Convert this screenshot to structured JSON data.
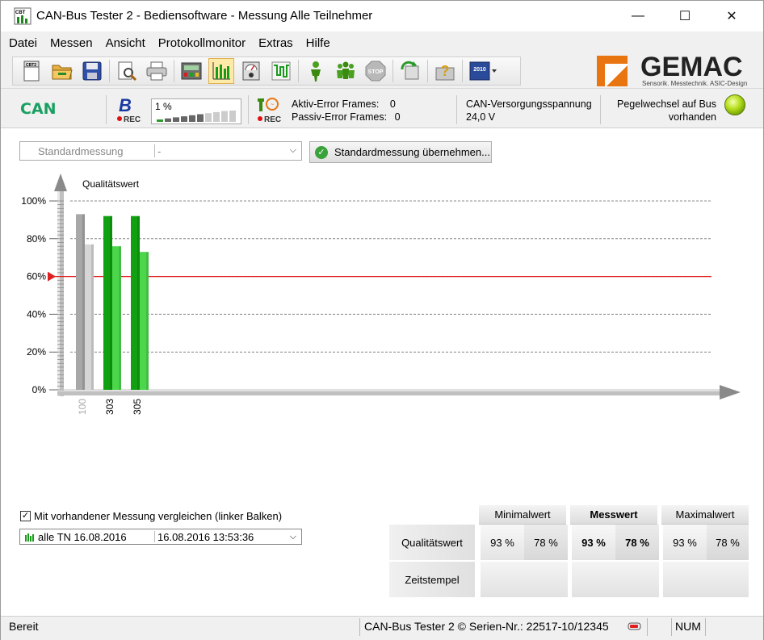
{
  "window": {
    "title": "CAN-Bus Tester 2 - Bediensoftware - Messung Alle Teilnehmer",
    "app_icon_text": "CBT",
    "controls": {
      "minimize": "—",
      "maximize": "☐",
      "close": "✕"
    }
  },
  "menu": [
    {
      "label": "Datei"
    },
    {
      "label": "Messen"
    },
    {
      "label": "Ansicht"
    },
    {
      "label": "Protokollmonitor"
    },
    {
      "label": "Extras"
    },
    {
      "label": "Hilfe"
    }
  ],
  "toolbar": {
    "icons": [
      "new-icon",
      "open-icon",
      "save-icon",
      "print-preview-icon",
      "print-icon",
      "device-icon",
      "bar-chart-icon",
      "meter-icon",
      "oscilloscope-icon",
      "person-icon",
      "group-icon",
      "stop-icon",
      "refresh-icon",
      "help-icon",
      "calendar-icon"
    ],
    "calendar_text": "2010",
    "stop_text": "STOP",
    "new_badge": "CBT2"
  },
  "logo": {
    "name": "GEMAC",
    "tagline": "Sensorik. Messtechnik. ASIC-Design"
  },
  "infobar": {
    "can_label": "CAN",
    "b_rec": {
      "letter": "B",
      "rec": "REC"
    },
    "level_percent": "1 %",
    "level_fill": 0.6,
    "t_rec": {
      "rec": "REC"
    },
    "aktiv_error_label": "Aktiv-Error Frames:",
    "aktiv_error_value": "0",
    "passiv_error_label": "Passiv-Error Frames:",
    "passiv_error_value": "0",
    "voltage_label": "CAN-Versorgungsspannung",
    "voltage_value": "24,0 V",
    "pegel_text": "Pegelwechsel auf Bus vorhanden",
    "pegel_led_color": "#b8e020"
  },
  "controls": {
    "mode_select_value": "Standardmessung",
    "mode_select_value2": "-",
    "apply_button_label": "Standardmessung übernehmen...",
    "compare_checkbox_label": "Mit vorhandener Messung vergleichen (linker Balken)",
    "compare_checked": true,
    "compare_select_value": "alle TN 16.08.2016",
    "compare_select_date": "16.08.2016  13:53:36"
  },
  "chart_data": {
    "type": "bar",
    "title": "Qualitätswert",
    "ylim": [
      0,
      100
    ],
    "y_ticks": [
      "0%",
      "20%",
      "40%",
      "60%",
      "80%",
      "100%"
    ],
    "threshold": 60,
    "threshold_color": "#e02020",
    "categories": [
      "100",
      "303",
      "305"
    ],
    "category_active": [
      false,
      true,
      true
    ],
    "series": [
      {
        "values": [
          93,
          92,
          92
        ],
        "colors": [
          "#a8a8a8",
          "#10a010",
          "#10a010"
        ]
      },
      {
        "values": [
          77,
          76,
          73
        ],
        "colors": [
          "#d6d6d6",
          "#4cd64c",
          "#4cd64c"
        ]
      }
    ]
  },
  "results": {
    "col_headers": [
      "Minimalwert",
      "Messwert",
      "Maximalwert"
    ],
    "row_labels": [
      "Qualitätswert",
      "Zeitstempel"
    ],
    "values": [
      [
        "93 %",
        "78 %"
      ],
      [
        "93 %",
        "78 %"
      ],
      [
        "93 %",
        "78 %"
      ]
    ]
  },
  "statusbar": {
    "ready": "Bereit",
    "product": "CAN-Bus Tester 2 ©  Serien-Nr.: 22517-10/12345",
    "num": "NUM"
  }
}
